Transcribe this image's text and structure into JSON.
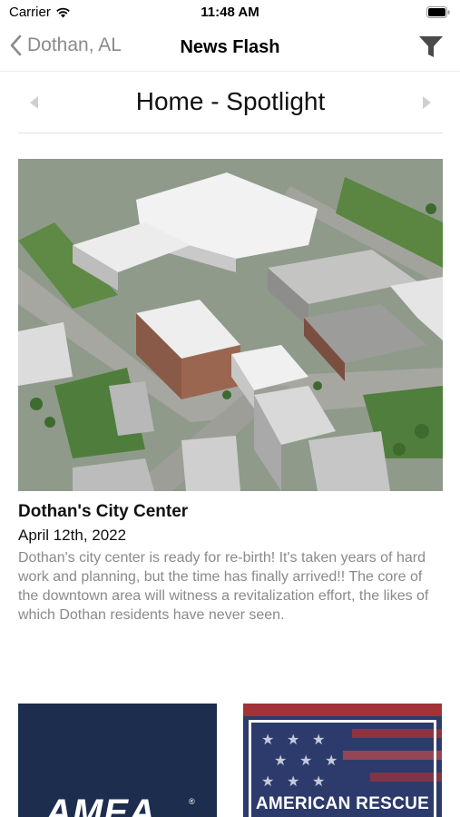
{
  "status_bar": {
    "carrier": "Carrier",
    "time": "11:48 AM"
  },
  "nav": {
    "back_label": "Dothan, AL",
    "title": "News Flash"
  },
  "section": {
    "label": "Home - Spotlight"
  },
  "article": {
    "title": "Dothan's City Center",
    "date": "April 12th, 2022",
    "body": "Dothan's city center is ready for re-birth! It's taken years of hard work and planning, but the time has finally arrived!! The core of the downtown area will witness a revitalization effort, the likes of which Dothan residents have never seen."
  },
  "tiles": [
    {
      "logo_text": "AMEA",
      "reg_mark": "®"
    },
    {
      "caption": "AMERICAN RESCUE"
    }
  ],
  "icons": {
    "back": "chevron-left-icon",
    "filter": "filter-icon",
    "prev": "triangle-left-icon",
    "next": "triangle-right-icon",
    "wifi": "wifi-icon",
    "battery": "battery-icon"
  },
  "colors": {
    "amea_navy": "#1c2d4e",
    "amea_red": "#d21f27",
    "muted_text": "#8a8a8a"
  }
}
